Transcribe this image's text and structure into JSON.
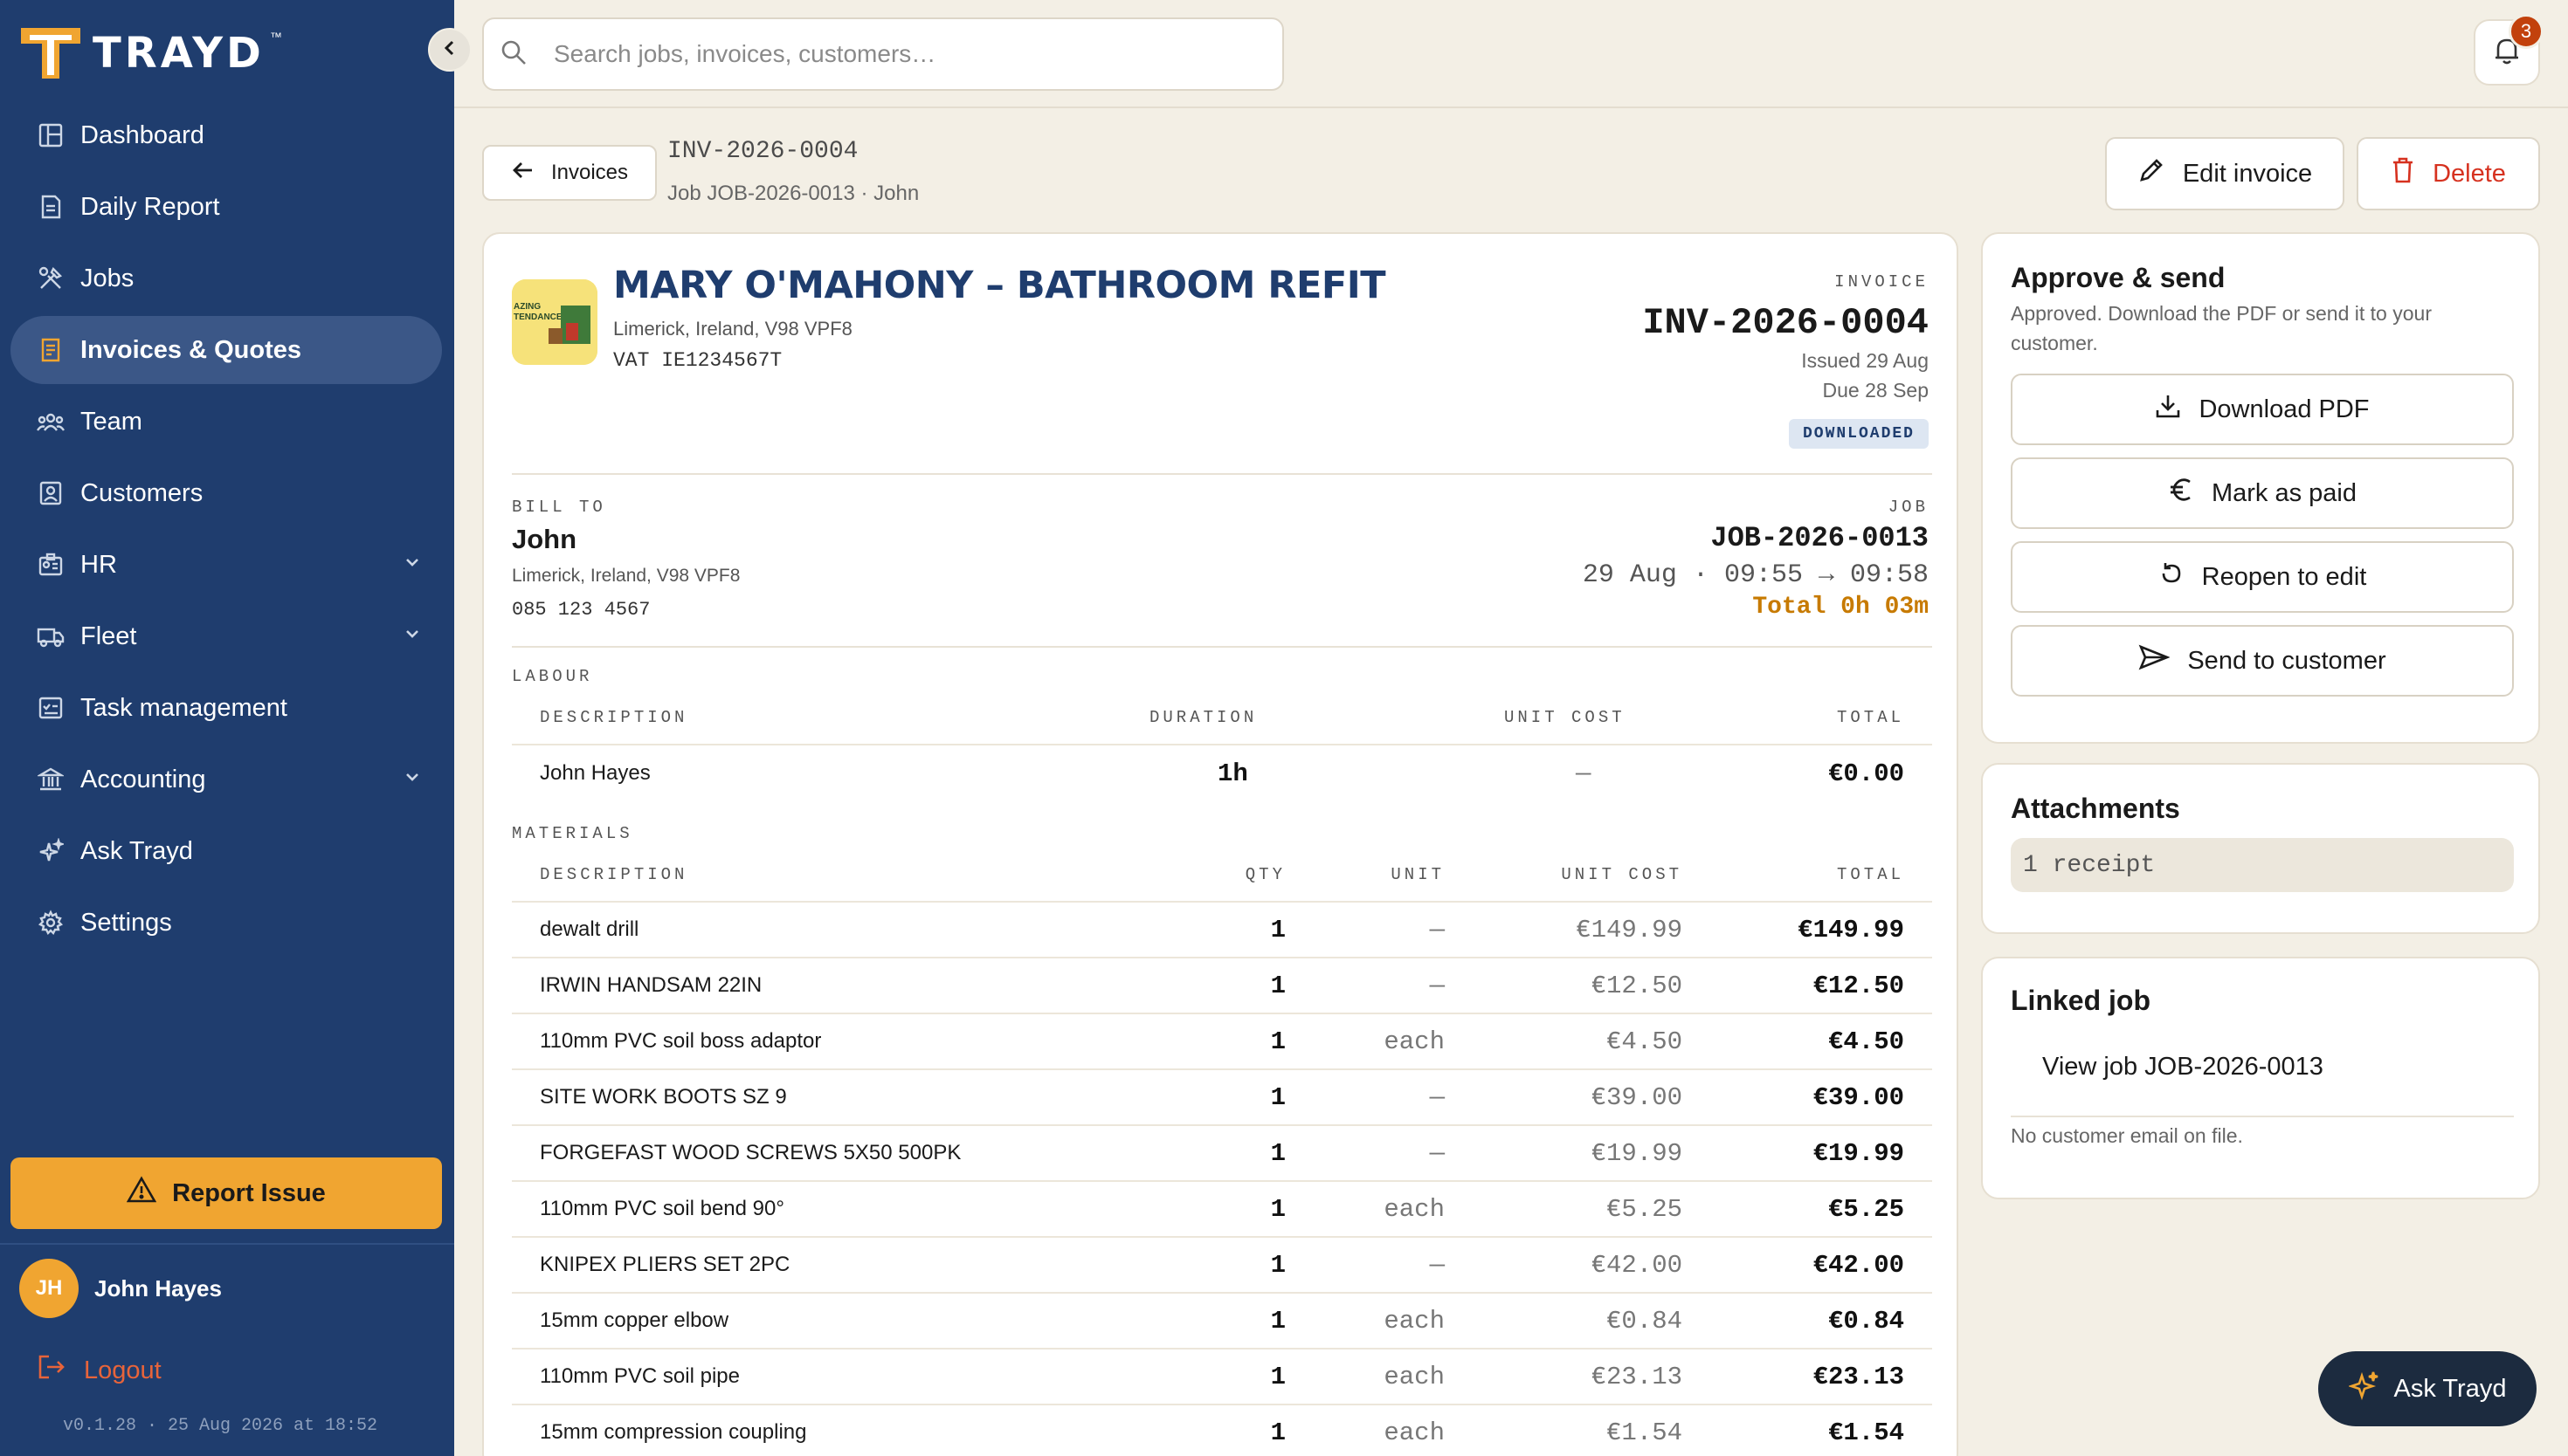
{
  "brand": {
    "name": "TRAYD",
    "tm": "™"
  },
  "sidebar": {
    "items": [
      {
        "label": "Dashboard"
      },
      {
        "label": "Daily Report"
      },
      {
        "label": "Jobs"
      },
      {
        "label": "Invoices & Quotes",
        "active": true
      },
      {
        "label": "Team"
      },
      {
        "label": "Customers"
      },
      {
        "label": "HR",
        "expandable": true
      },
      {
        "label": "Fleet",
        "expandable": true
      },
      {
        "label": "Task management"
      },
      {
        "label": "Accounting",
        "expandable": true
      },
      {
        "label": "Ask Trayd"
      },
      {
        "label": "Settings"
      }
    ],
    "report_issue": "Report Issue",
    "user": {
      "initials": "JH",
      "name": "John Hayes"
    },
    "logout": "Logout",
    "version": "v0.1.28 · 25 Aug 2026 at 18:52"
  },
  "search": {
    "placeholder": "Search jobs, invoices, customers…",
    "value": ""
  },
  "notifications": {
    "count": "3"
  },
  "header": {
    "back_label": "Invoices",
    "invoice_id": "INV-2026-0004",
    "subtitle": "Job JOB-2026-0013 · John",
    "edit_label": "Edit invoice",
    "delete_label": "Delete"
  },
  "invoice": {
    "customer_title": "MARY O'MAHONY – BATHROOM REFIT",
    "customer_address": "Limerick, Ireland, V98 VPF8",
    "vat": "VAT IE1234567T",
    "label": "INVOICE",
    "number": "INV-2026-0004",
    "issued": "Issued 29 Aug",
    "due": "Due 28 Sep",
    "status": "DOWNLOADED",
    "bill_to_label": "BILL TO",
    "bill_name": "John",
    "bill_address": "Limerick, Ireland, V98 VPF8",
    "bill_phone": "085 123 4567",
    "job_label": "JOB",
    "job_number": "JOB-2026-0013",
    "job_time": "29 Aug · 09:55 → 09:58",
    "job_total": "Total 0h 03m",
    "labour": {
      "section": "LABOUR",
      "headers": [
        "DESCRIPTION",
        "DURATION",
        "UNIT COST",
        "TOTAL"
      ],
      "rows": [
        {
          "desc": "John Hayes",
          "duration": "1h",
          "unit_cost": "—",
          "total": "€0.00"
        }
      ]
    },
    "materials": {
      "section": "MATERIALS",
      "headers": [
        "DESCRIPTION",
        "QTY",
        "UNIT",
        "UNIT COST",
        "TOTAL"
      ],
      "rows": [
        {
          "desc": "dewalt drill",
          "qty": "1",
          "unit": "—",
          "unit_cost": "€149.99",
          "total": "€149.99"
        },
        {
          "desc": "IRWIN HANDSAM 22IN",
          "qty": "1",
          "unit": "—",
          "unit_cost": "€12.50",
          "total": "€12.50"
        },
        {
          "desc": "110mm PVC soil boss adaptor",
          "qty": "1",
          "unit": "each",
          "unit_cost": "€4.50",
          "total": "€4.50"
        },
        {
          "desc": "SITE WORK BOOTS SZ 9",
          "qty": "1",
          "unit": "—",
          "unit_cost": "€39.00",
          "total": "€39.00"
        },
        {
          "desc": "FORGEFAST WOOD SCREWS 5X50 500PK",
          "qty": "1",
          "unit": "—",
          "unit_cost": "€19.99",
          "total": "€19.99"
        },
        {
          "desc": "110mm PVC soil bend 90°",
          "qty": "1",
          "unit": "each",
          "unit_cost": "€5.25",
          "total": "€5.25"
        },
        {
          "desc": "KNIPEX PLIERS SET 2PC",
          "qty": "1",
          "unit": "—",
          "unit_cost": "€42.00",
          "total": "€42.00"
        },
        {
          "desc": "15mm copper elbow",
          "qty": "1",
          "unit": "each",
          "unit_cost": "€0.84",
          "total": "€0.84"
        },
        {
          "desc": "110mm PVC soil pipe",
          "qty": "1",
          "unit": "each",
          "unit_cost": "€23.13",
          "total": "€23.13"
        },
        {
          "desc": "15mm compression coupling",
          "qty": "1",
          "unit": "each",
          "unit_cost": "€1.54",
          "total": "€1.54"
        }
      ]
    }
  },
  "approve": {
    "title": "Approve & send",
    "subtitle": "Approved. Download the PDF or send it to your customer.",
    "download": "Download PDF",
    "mark_paid": "Mark as paid",
    "reopen": "Reopen to edit",
    "send": "Send to customer"
  },
  "attachments": {
    "title": "Attachments",
    "receipt": "1 receipt"
  },
  "linked_job": {
    "title": "Linked job",
    "link": "View job JOB-2026-0013",
    "note": "No customer email on file."
  },
  "ask_trayd": "Ask Trayd",
  "colors": {
    "sidebar": "#1f3d6e",
    "accent": "#f0a531",
    "danger": "#d6311f",
    "background": "#f3efe5"
  }
}
